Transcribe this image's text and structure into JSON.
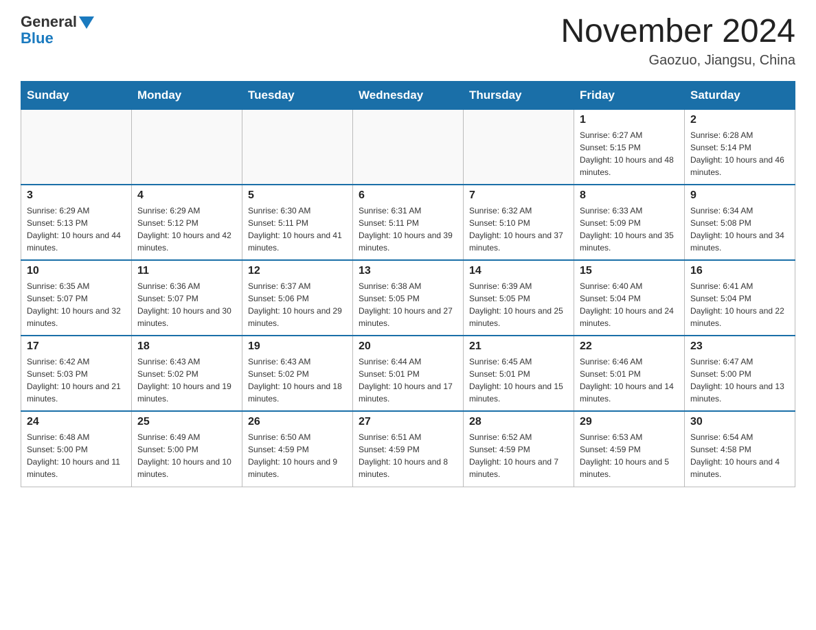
{
  "header": {
    "logo_general": "General",
    "logo_blue": "Blue",
    "month_title": "November 2024",
    "location": "Gaozuo, Jiangsu, China"
  },
  "weekdays": [
    "Sunday",
    "Monday",
    "Tuesday",
    "Wednesday",
    "Thursday",
    "Friday",
    "Saturday"
  ],
  "rows": [
    [
      {
        "day": "",
        "sunrise": "",
        "sunset": "",
        "daylight": ""
      },
      {
        "day": "",
        "sunrise": "",
        "sunset": "",
        "daylight": ""
      },
      {
        "day": "",
        "sunrise": "",
        "sunset": "",
        "daylight": ""
      },
      {
        "day": "",
        "sunrise": "",
        "sunset": "",
        "daylight": ""
      },
      {
        "day": "",
        "sunrise": "",
        "sunset": "",
        "daylight": ""
      },
      {
        "day": "1",
        "sunrise": "Sunrise: 6:27 AM",
        "sunset": "Sunset: 5:15 PM",
        "daylight": "Daylight: 10 hours and 48 minutes."
      },
      {
        "day": "2",
        "sunrise": "Sunrise: 6:28 AM",
        "sunset": "Sunset: 5:14 PM",
        "daylight": "Daylight: 10 hours and 46 minutes."
      }
    ],
    [
      {
        "day": "3",
        "sunrise": "Sunrise: 6:29 AM",
        "sunset": "Sunset: 5:13 PM",
        "daylight": "Daylight: 10 hours and 44 minutes."
      },
      {
        "day": "4",
        "sunrise": "Sunrise: 6:29 AM",
        "sunset": "Sunset: 5:12 PM",
        "daylight": "Daylight: 10 hours and 42 minutes."
      },
      {
        "day": "5",
        "sunrise": "Sunrise: 6:30 AM",
        "sunset": "Sunset: 5:11 PM",
        "daylight": "Daylight: 10 hours and 41 minutes."
      },
      {
        "day": "6",
        "sunrise": "Sunrise: 6:31 AM",
        "sunset": "Sunset: 5:11 PM",
        "daylight": "Daylight: 10 hours and 39 minutes."
      },
      {
        "day": "7",
        "sunrise": "Sunrise: 6:32 AM",
        "sunset": "Sunset: 5:10 PM",
        "daylight": "Daylight: 10 hours and 37 minutes."
      },
      {
        "day": "8",
        "sunrise": "Sunrise: 6:33 AM",
        "sunset": "Sunset: 5:09 PM",
        "daylight": "Daylight: 10 hours and 35 minutes."
      },
      {
        "day": "9",
        "sunrise": "Sunrise: 6:34 AM",
        "sunset": "Sunset: 5:08 PM",
        "daylight": "Daylight: 10 hours and 34 minutes."
      }
    ],
    [
      {
        "day": "10",
        "sunrise": "Sunrise: 6:35 AM",
        "sunset": "Sunset: 5:07 PM",
        "daylight": "Daylight: 10 hours and 32 minutes."
      },
      {
        "day": "11",
        "sunrise": "Sunrise: 6:36 AM",
        "sunset": "Sunset: 5:07 PM",
        "daylight": "Daylight: 10 hours and 30 minutes."
      },
      {
        "day": "12",
        "sunrise": "Sunrise: 6:37 AM",
        "sunset": "Sunset: 5:06 PM",
        "daylight": "Daylight: 10 hours and 29 minutes."
      },
      {
        "day": "13",
        "sunrise": "Sunrise: 6:38 AM",
        "sunset": "Sunset: 5:05 PM",
        "daylight": "Daylight: 10 hours and 27 minutes."
      },
      {
        "day": "14",
        "sunrise": "Sunrise: 6:39 AM",
        "sunset": "Sunset: 5:05 PM",
        "daylight": "Daylight: 10 hours and 25 minutes."
      },
      {
        "day": "15",
        "sunrise": "Sunrise: 6:40 AM",
        "sunset": "Sunset: 5:04 PM",
        "daylight": "Daylight: 10 hours and 24 minutes."
      },
      {
        "day": "16",
        "sunrise": "Sunrise: 6:41 AM",
        "sunset": "Sunset: 5:04 PM",
        "daylight": "Daylight: 10 hours and 22 minutes."
      }
    ],
    [
      {
        "day": "17",
        "sunrise": "Sunrise: 6:42 AM",
        "sunset": "Sunset: 5:03 PM",
        "daylight": "Daylight: 10 hours and 21 minutes."
      },
      {
        "day": "18",
        "sunrise": "Sunrise: 6:43 AM",
        "sunset": "Sunset: 5:02 PM",
        "daylight": "Daylight: 10 hours and 19 minutes."
      },
      {
        "day": "19",
        "sunrise": "Sunrise: 6:43 AM",
        "sunset": "Sunset: 5:02 PM",
        "daylight": "Daylight: 10 hours and 18 minutes."
      },
      {
        "day": "20",
        "sunrise": "Sunrise: 6:44 AM",
        "sunset": "Sunset: 5:01 PM",
        "daylight": "Daylight: 10 hours and 17 minutes."
      },
      {
        "day": "21",
        "sunrise": "Sunrise: 6:45 AM",
        "sunset": "Sunset: 5:01 PM",
        "daylight": "Daylight: 10 hours and 15 minutes."
      },
      {
        "day": "22",
        "sunrise": "Sunrise: 6:46 AM",
        "sunset": "Sunset: 5:01 PM",
        "daylight": "Daylight: 10 hours and 14 minutes."
      },
      {
        "day": "23",
        "sunrise": "Sunrise: 6:47 AM",
        "sunset": "Sunset: 5:00 PM",
        "daylight": "Daylight: 10 hours and 13 minutes."
      }
    ],
    [
      {
        "day": "24",
        "sunrise": "Sunrise: 6:48 AM",
        "sunset": "Sunset: 5:00 PM",
        "daylight": "Daylight: 10 hours and 11 minutes."
      },
      {
        "day": "25",
        "sunrise": "Sunrise: 6:49 AM",
        "sunset": "Sunset: 5:00 PM",
        "daylight": "Daylight: 10 hours and 10 minutes."
      },
      {
        "day": "26",
        "sunrise": "Sunrise: 6:50 AM",
        "sunset": "Sunset: 4:59 PM",
        "daylight": "Daylight: 10 hours and 9 minutes."
      },
      {
        "day": "27",
        "sunrise": "Sunrise: 6:51 AM",
        "sunset": "Sunset: 4:59 PM",
        "daylight": "Daylight: 10 hours and 8 minutes."
      },
      {
        "day": "28",
        "sunrise": "Sunrise: 6:52 AM",
        "sunset": "Sunset: 4:59 PM",
        "daylight": "Daylight: 10 hours and 7 minutes."
      },
      {
        "day": "29",
        "sunrise": "Sunrise: 6:53 AM",
        "sunset": "Sunset: 4:59 PM",
        "daylight": "Daylight: 10 hours and 5 minutes."
      },
      {
        "day": "30",
        "sunrise": "Sunrise: 6:54 AM",
        "sunset": "Sunset: 4:58 PM",
        "daylight": "Daylight: 10 hours and 4 minutes."
      }
    ]
  ]
}
